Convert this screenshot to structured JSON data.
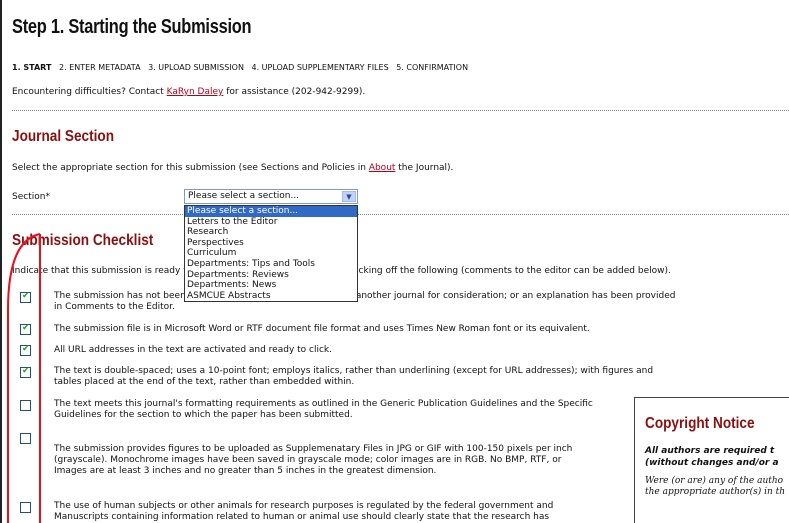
{
  "page_title": "Step 1. Starting the Submission",
  "steps": [
    {
      "label": "1. START"
    },
    {
      "label": "2. ENTER METADATA"
    },
    {
      "label": "3. UPLOAD SUBMISSION"
    },
    {
      "label": "4. UPLOAD SUPPLEMENTARY FILES"
    },
    {
      "label": "5. CONFIRMATION"
    }
  ],
  "contact": {
    "prefix": "Encountering difficulties? Contact ",
    "name": "KaRyn Daley",
    "suffix": " for assistance (202-942-9299)."
  },
  "journal_section": {
    "heading": "Journal Section",
    "intro_prefix": "Select the appropriate section for this submission (see Sections and Policies in ",
    "about_link": "About",
    "intro_suffix": " the Journal).",
    "section_label": "Section*",
    "selected": "Please select a section...",
    "options": [
      "Please select a section...",
      "Letters to the Editor",
      "Research",
      "Perspectives",
      "Curriculum",
      "Departments: Tips and Tools",
      "Departments: Reviews",
      "Departments: News",
      "ASMCUE Abstracts"
    ]
  },
  "checklist": {
    "heading": "Submission Checklist",
    "intro": "Indicate that this submission is ready to be considered by this journal by checking off the following (comments to the editor can be added below).",
    "items": [
      {
        "checked": true,
        "line1": "The submission has not been previously published, nor is it before another journal for consideration; or an explanation has been provided",
        "line2": "in Comments to the Editor."
      },
      {
        "checked": true,
        "line1": "The submission file is in Microsoft Word or RTF document file format and uses Times New Roman font or its equivalent.",
        "line2": ""
      },
      {
        "checked": true,
        "line1": "All URL addresses in the text are activated and ready to click.",
        "line2": ""
      },
      {
        "checked": true,
        "line1": "The text is double-spaced; uses a 10-point font; employs italics, rather than underlining (except for URL addresses);  with figures and",
        "line2": "tables placed at the end of the text, rather than embedded within."
      },
      {
        "checked": false,
        "line1": "The text meets this journal's formatting requirements as outlined in the Generic Publication Guidelines and the Specific",
        "line2": "Guidelines for the section to which the paper has been submitted."
      },
      {
        "checked": false,
        "line1": "The submission provides figures to be uploaded as Supplemenatary Files in JPG or GIF with 100-150 pixels per inch",
        "line2": "(grayscale). Monochrome images have been saved in grayscale mode; color images are in RGB. No BMP, RTF, or",
        "line3": "Images are at least 3 inches and no greater than 5 inches in the greatest dimension."
      },
      {
        "checked": false,
        "line1": "The use of human subjects or other animals for research purposes is regulated by the federal government and",
        "line2": "Manuscripts containing information related to human or animal use should clearly state that the research has"
      }
    ]
  },
  "copyright": {
    "heading": "Copyright Notice",
    "bold_line1": "All authors are required t",
    "bold_line2": "(without changes and/or a",
    "serif_line1": "Were (or are) any of the autho",
    "serif_line2": "the appropriate author(s) in th"
  }
}
